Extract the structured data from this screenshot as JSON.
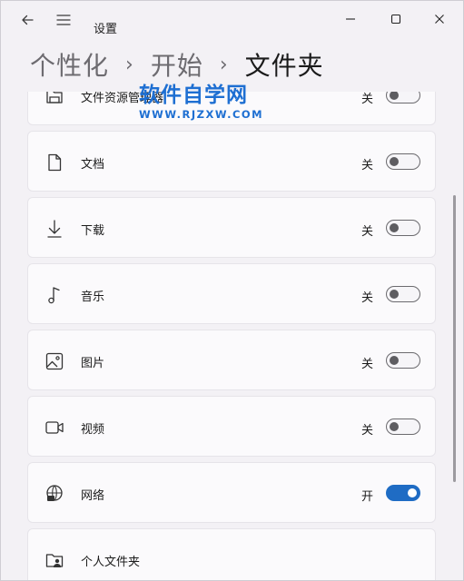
{
  "window": {
    "app_title": "设置",
    "back_icon": "arrow-left-icon",
    "menu_icon": "hamburger-icon",
    "controls": [
      "minimize-icon",
      "maximize-icon",
      "close-icon"
    ]
  },
  "breadcrumb": {
    "items": [
      "个性化",
      "开始",
      "文件夹"
    ],
    "separator": "›"
  },
  "watermark": {
    "title": "软件自学网",
    "url": "WWW.RJZXW.COM"
  },
  "folders": [
    {
      "label": "文件资源管理器",
      "icon": "file-explorer-icon",
      "state": "关",
      "on": false
    },
    {
      "label": "文档",
      "icon": "document-icon",
      "state": "关",
      "on": false
    },
    {
      "label": "下载",
      "icon": "download-icon",
      "state": "关",
      "on": false
    },
    {
      "label": "音乐",
      "icon": "music-icon",
      "state": "关",
      "on": false
    },
    {
      "label": "图片",
      "icon": "picture-icon",
      "state": "关",
      "on": false
    },
    {
      "label": "视频",
      "icon": "video-icon",
      "state": "关",
      "on": false
    },
    {
      "label": "网络",
      "icon": "network-icon",
      "state": "开",
      "on": true
    },
    {
      "label": "个人文件夹",
      "icon": "personal-folder-icon",
      "state": "",
      "on": false
    }
  ],
  "colors": {
    "accent": "#1f6cc4",
    "watermark": "#1e6fd2"
  }
}
